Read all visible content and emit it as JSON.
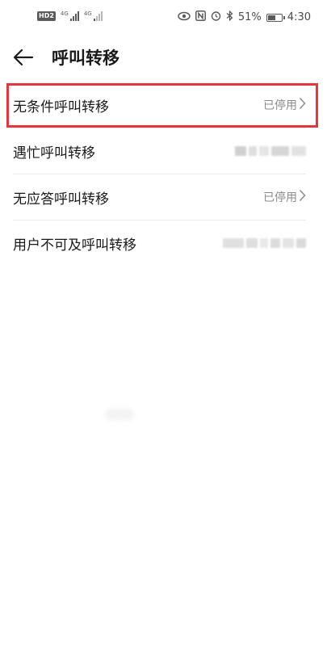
{
  "status_bar": {
    "hd_label": "HD",
    "sim_badge": "2",
    "net1_label": "4G",
    "net2_label": "4G",
    "battery_percent": "51%",
    "battery_level": 0.51,
    "time": "4:30",
    "icons": [
      "eye-icon",
      "nfc-icon",
      "alarm-icon",
      "bluetooth-icon",
      "battery-icon"
    ]
  },
  "header": {
    "title": "呼叫转移"
  },
  "items": [
    {
      "label": "无条件呼叫转移",
      "status": "已停用"
    },
    {
      "label": "遇忙呼叫转移",
      "status": ""
    },
    {
      "label": "无应答呼叫转移",
      "status": "已停用"
    },
    {
      "label": "用户不可及呼叫转移",
      "status": ""
    }
  ],
  "colors": {
    "highlight": "#e8343d",
    "status_text": "#8a8a8a"
  }
}
